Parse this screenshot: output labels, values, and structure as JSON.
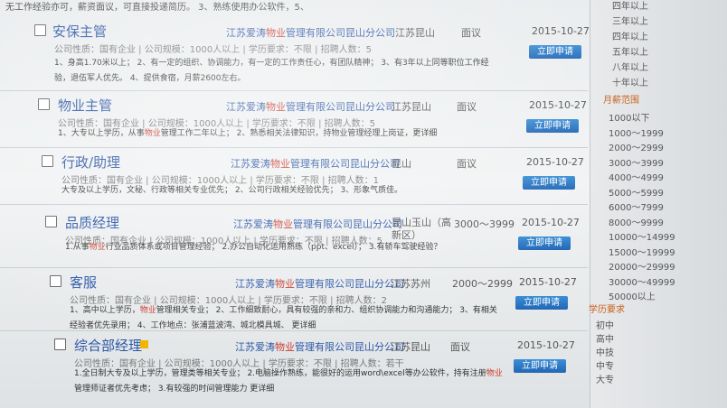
{
  "top_line": "无工作经验亦可，薪资面议，可直接投递简历。                                              3、熟练使用办公软件，5、",
  "apply_label": "立即申请",
  "jobs": [
    {
      "title": "安保主管",
      "company_pre": "江苏爱涛",
      "company_hl": "物业",
      "company_post": "管理有限公司昆山分公司",
      "location": "江苏昆山",
      "salary": "面议",
      "date": "2015-10-27",
      "meta": "公司性质：国有企业 | 公司规模：1000人以上 | 学历要求：不限 | 招聘人数：5",
      "desc1_pre": "1、身高1.70米以上；  2、有一定的组织、协调能力，有一定的工作责任心，有团队精神；  3、有3年以上同等职位工作经",
      "desc1_hl": "",
      "desc1_post": "",
      "desc2": "验，退伍军人优先。 4、提供食宿，月薪2600左右。"
    },
    {
      "title": "物业主管",
      "company_pre": "江苏爱涛",
      "company_hl": "物业",
      "company_post": "管理有限公司昆山分公司",
      "location": "江苏昆山",
      "salary": "面议",
      "date": "2015-10-27",
      "meta": "公司性质：国有企业 | 公司规模：1000人以上 | 学历要求：不限 | 招聘人数：5",
      "desc1_pre": "1、大专以上学历，从事",
      "desc1_hl": "物业",
      "desc1_post": "管理工作二年以上；  2、熟悉相关法律知识，持物业管理经理上岗证，更详细",
      "desc2": ""
    },
    {
      "title": "行政/助理",
      "company_pre": "江苏爱涛",
      "company_hl": "物业",
      "company_post": "管理有限公司昆山分公司",
      "location": "昆山",
      "salary": "面议",
      "date": "2015-10-27",
      "meta": "公司性质：国有企业 | 公司规模：1000人以上 | 学历要求：不限 | 招聘人数：1",
      "desc1_pre": "大专及以上学历，文秘、行政等相关专业优先； 2、公司行政相关经验优先； 3、形象气质佳。",
      "desc1_hl": "",
      "desc1_post": "",
      "desc2": ""
    },
    {
      "title": "品质经理",
      "company_pre": "江苏爱涛",
      "company_hl": "物业",
      "company_post": "管理有限公司昆山分公司",
      "location": "昆山玉山（高新区）",
      "salary": "3000～3999",
      "date": "2015-10-27",
      "meta": "公司性质：国有企业 | 公司规模：1000人以上 | 学历要求：不限 | 招聘人数：5",
      "desc1_pre": "1.从事",
      "desc1_hl": "物业",
      "desc1_post": "行业品质体系或项目管理经验；  2.办公自动化运用熟练（ppt、excel）； 3.有轿车驾驶经验？",
      "desc2": ""
    },
    {
      "title": "客服",
      "company_pre": "江苏爱涛",
      "company_hl": "物业",
      "company_post": "管理有限公司昆山分公司",
      "location": "江苏苏州",
      "salary": "2000～2999",
      "date": "2015-10-27",
      "meta": "公司性质：国有企业 | 公司规模：1000人以上 | 学历要求：不限 | 招聘人数：2",
      "desc1_pre": "1、高中以上学历，",
      "desc1_hl": "物业",
      "desc1_post": "管理相关专业；  2、工作细致耐心，具有较强的亲和力、组织协调能力和沟通能力；  3、有相关",
      "desc2": "经验者优先录用；  4、工作地点：张浦蓝波湾、城北模具城、  更详细"
    },
    {
      "title": "综合部经理",
      "company_pre": "江苏爱涛",
      "company_hl": "物业",
      "company_post": "管理有限公司昆山分公司",
      "location": "江苏昆山",
      "salary": "面议",
      "date": "2015-10-27",
      "meta": "公司性质：国有企业 | 公司规模：1000人以上 | 学历要求：不限 | 招聘人数：若干",
      "desc1_pre": "1.全日制大专及以上学历，管理类等相关专业；  2.电脑操作熟练，能很好的运用word\\excel等办公软件，持有注册",
      "desc1_hl": "物业",
      "desc1_post": "",
      "desc2": "管理师证者优先考虑；  3.有较强的时间管理能力  更详细"
    }
  ],
  "sidebar": {
    "experience": [
      "四年以上",
      "三年以上",
      "四年以上",
      "五年以上",
      "八年以上",
      "十年以上"
    ],
    "salary_head": "月薪范围",
    "salary": [
      "1000以下",
      "1000～1999",
      "2000～2999",
      "3000～3999",
      "4000～4999",
      "5000～5999",
      "6000～7999",
      "8000～9999",
      "10000～14999",
      "15000～19999",
      "20000～29999",
      "30000～49999",
      "50000以上"
    ],
    "edu_head": "学历要求",
    "edu": [
      "初中",
      "高中",
      "中技",
      "中专",
      "大专"
    ]
  }
}
